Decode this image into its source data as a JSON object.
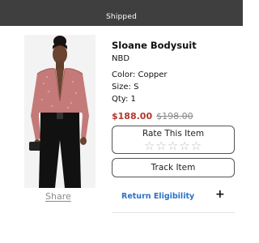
{
  "status_bar": {
    "label": "Shipped"
  },
  "product": {
    "name": "Sloane Bodysuit",
    "brand": "NBD",
    "color_line": "Color: Copper",
    "size_line": "Size: S",
    "qty_line": "Qty: 1",
    "sale_price": "$188.00",
    "original_price": "$198.00",
    "image_icon": "product-photo"
  },
  "rating": {
    "label": "Rate This Item",
    "stars": "☆☆☆☆☆",
    "max": 5,
    "current": 0
  },
  "actions": {
    "share_label": "Share",
    "track_label": "Track Item",
    "return_label": "Return Eligibility",
    "expand_glyph": "+"
  },
  "colors": {
    "status_bg": "#3f3f3f",
    "sale_price": "#b5362b",
    "link": "#2a72c8"
  }
}
